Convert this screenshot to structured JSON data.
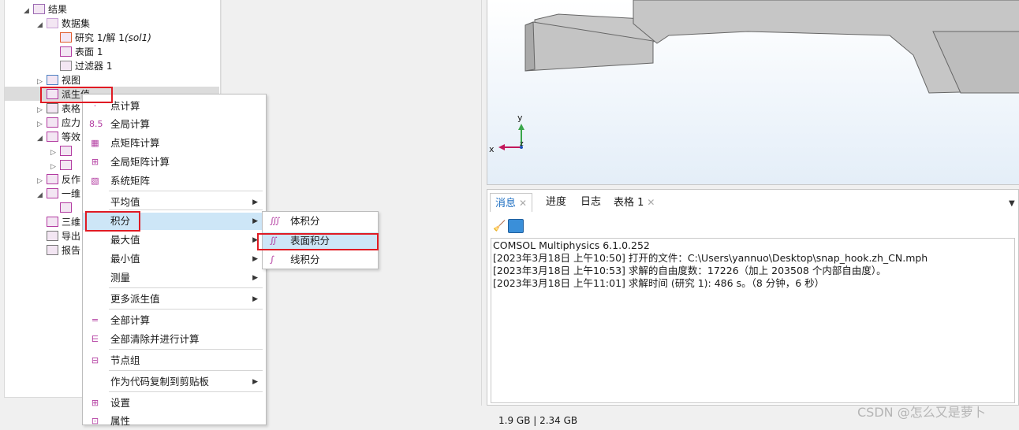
{
  "tree": {
    "items": [
      {
        "label": "结果",
        "arrow": "◢",
        "icon": "results-icon",
        "indent": 0
      },
      {
        "label": "数据集",
        "arrow": "◢",
        "icon": "datasets-icon",
        "indent": 1
      },
      {
        "label": "研究 1/解 1",
        "suffix": "(sol1)",
        "arrow": "",
        "icon": "solution-icon",
        "indent": 2
      },
      {
        "label": "表面 1",
        "arrow": "",
        "icon": "surface-icon",
        "indent": 2
      },
      {
        "label": "过滤器 1",
        "arrow": "",
        "icon": "filter-icon",
        "indent": 2
      },
      {
        "label": "视图",
        "arrow": "▷",
        "icon": "views-icon",
        "indent": 1
      },
      {
        "label": "派生值",
        "arrow": "",
        "icon": "derived-values-icon",
        "indent": 1
      },
      {
        "label": "表格",
        "arrow": "▷",
        "icon": "tables-icon",
        "indent": 1
      },
      {
        "label": "应力",
        "arrow": "▷",
        "icon": "stress-icon",
        "indent": 1
      },
      {
        "label": "等效",
        "arrow": "◢",
        "icon": "equivalent-icon",
        "indent": 1
      },
      {
        "label": "",
        "arrow": "▷",
        "icon": "plot-icon",
        "indent": 2
      },
      {
        "label": "",
        "arrow": "▷",
        "icon": "plot-icon",
        "indent": 2
      },
      {
        "label": "反作",
        "arrow": "▷",
        "icon": "reaction-icon",
        "indent": 1
      },
      {
        "label": "一维",
        "arrow": "◢",
        "icon": "line-plot-icon",
        "indent": 1
      },
      {
        "label": "",
        "arrow": "",
        "icon": "graph-icon",
        "indent": 2
      },
      {
        "label": "三维",
        "arrow": "",
        "icon": "3d-icon",
        "indent": 1
      },
      {
        "label": "导出",
        "arrow": "",
        "icon": "export-icon",
        "indent": 1
      },
      {
        "label": "报告",
        "arrow": "",
        "icon": "report-icon",
        "indent": 1
      }
    ]
  },
  "graphics": {
    "axis_y": "y",
    "axis_x": "x",
    "axis_z": "z"
  },
  "messages": {
    "tabs": [
      {
        "label": "消息",
        "closable": true,
        "active": true
      },
      {
        "label": "进度",
        "closable": false,
        "active": false
      },
      {
        "label": "日志",
        "closable": false,
        "active": false
      },
      {
        "label": "表格 1",
        "closable": true,
        "active": false
      }
    ],
    "close_glyph": "✕",
    "lines": [
      "COMSOL Multiphysics 6.1.0.252",
      "[2023年3月18日 上午10:50] 打开的文件：C:\\Users\\yannuo\\Desktop\\snap_hook.zh_CN.mph",
      "[2023年3月18日 上午10:53] 求解的自由度数：17226（加上 203508 个内部自由度）。",
      "[2023年3月18日 上午11:01] 求解时间 (研究 1): 486 s。（8 分钟，6 秒）"
    ]
  },
  "status": {
    "memory": "1.9 GB | 2.34 GB"
  },
  "watermark": "CSDN @怎么又是萝卜",
  "context_menu": {
    "items": [
      {
        "label": "点计算",
        "icon": "point-eval-icon",
        "glyph": "·",
        "submenu": false
      },
      {
        "label": "全局计算",
        "icon": "global-eval-icon",
        "glyph": "8.5",
        "submenu": false
      },
      {
        "label": "点矩阵计算",
        "icon": "point-matrix-icon",
        "glyph": "▦",
        "submenu": false
      },
      {
        "label": "全局矩阵计算",
        "icon": "global-matrix-icon",
        "glyph": "⊞",
        "submenu": false
      },
      {
        "label": "系统矩阵",
        "icon": "system-matrix-icon",
        "glyph": "▧",
        "submenu": false
      },
      {
        "label": "平均值",
        "icon": "",
        "glyph": "",
        "submenu": true
      },
      {
        "label": "积分",
        "icon": "",
        "glyph": "",
        "submenu": true,
        "highlighted": true
      },
      {
        "label": "最大值",
        "icon": "",
        "glyph": "",
        "submenu": true
      },
      {
        "label": "最小值",
        "icon": "",
        "glyph": "",
        "submenu": true
      },
      {
        "label": "测量",
        "icon": "",
        "glyph": "",
        "submenu": true
      },
      {
        "label": "更多派生值",
        "icon": "",
        "glyph": "",
        "submenu": true
      },
      {
        "label": "全部计算",
        "icon": "evaluate-all-icon",
        "glyph": "=",
        "submenu": false
      },
      {
        "label": "全部清除并进行计算",
        "icon": "clear-evaluate-icon",
        "glyph": "⋿",
        "submenu": false
      },
      {
        "label": "节点组",
        "icon": "node-group-icon",
        "glyph": "⊟",
        "submenu": false
      },
      {
        "label": "作为代码复制到剪贴板",
        "icon": "",
        "glyph": "",
        "submenu": true
      },
      {
        "label": "设置",
        "icon": "settings-icon",
        "glyph": "⊞",
        "submenu": false
      },
      {
        "label": "属性",
        "icon": "properties-icon",
        "glyph": "⊡",
        "submenu": false
      }
    ],
    "submenu_arrow": "▶"
  },
  "integration_submenu": {
    "items": [
      {
        "label": "体积分",
        "glyph": "∭",
        "highlighted": false
      },
      {
        "label": "表面积分",
        "glyph": "∬",
        "highlighted": true
      },
      {
        "label": "线积分",
        "glyph": "∫",
        "highlighted": false
      }
    ]
  }
}
